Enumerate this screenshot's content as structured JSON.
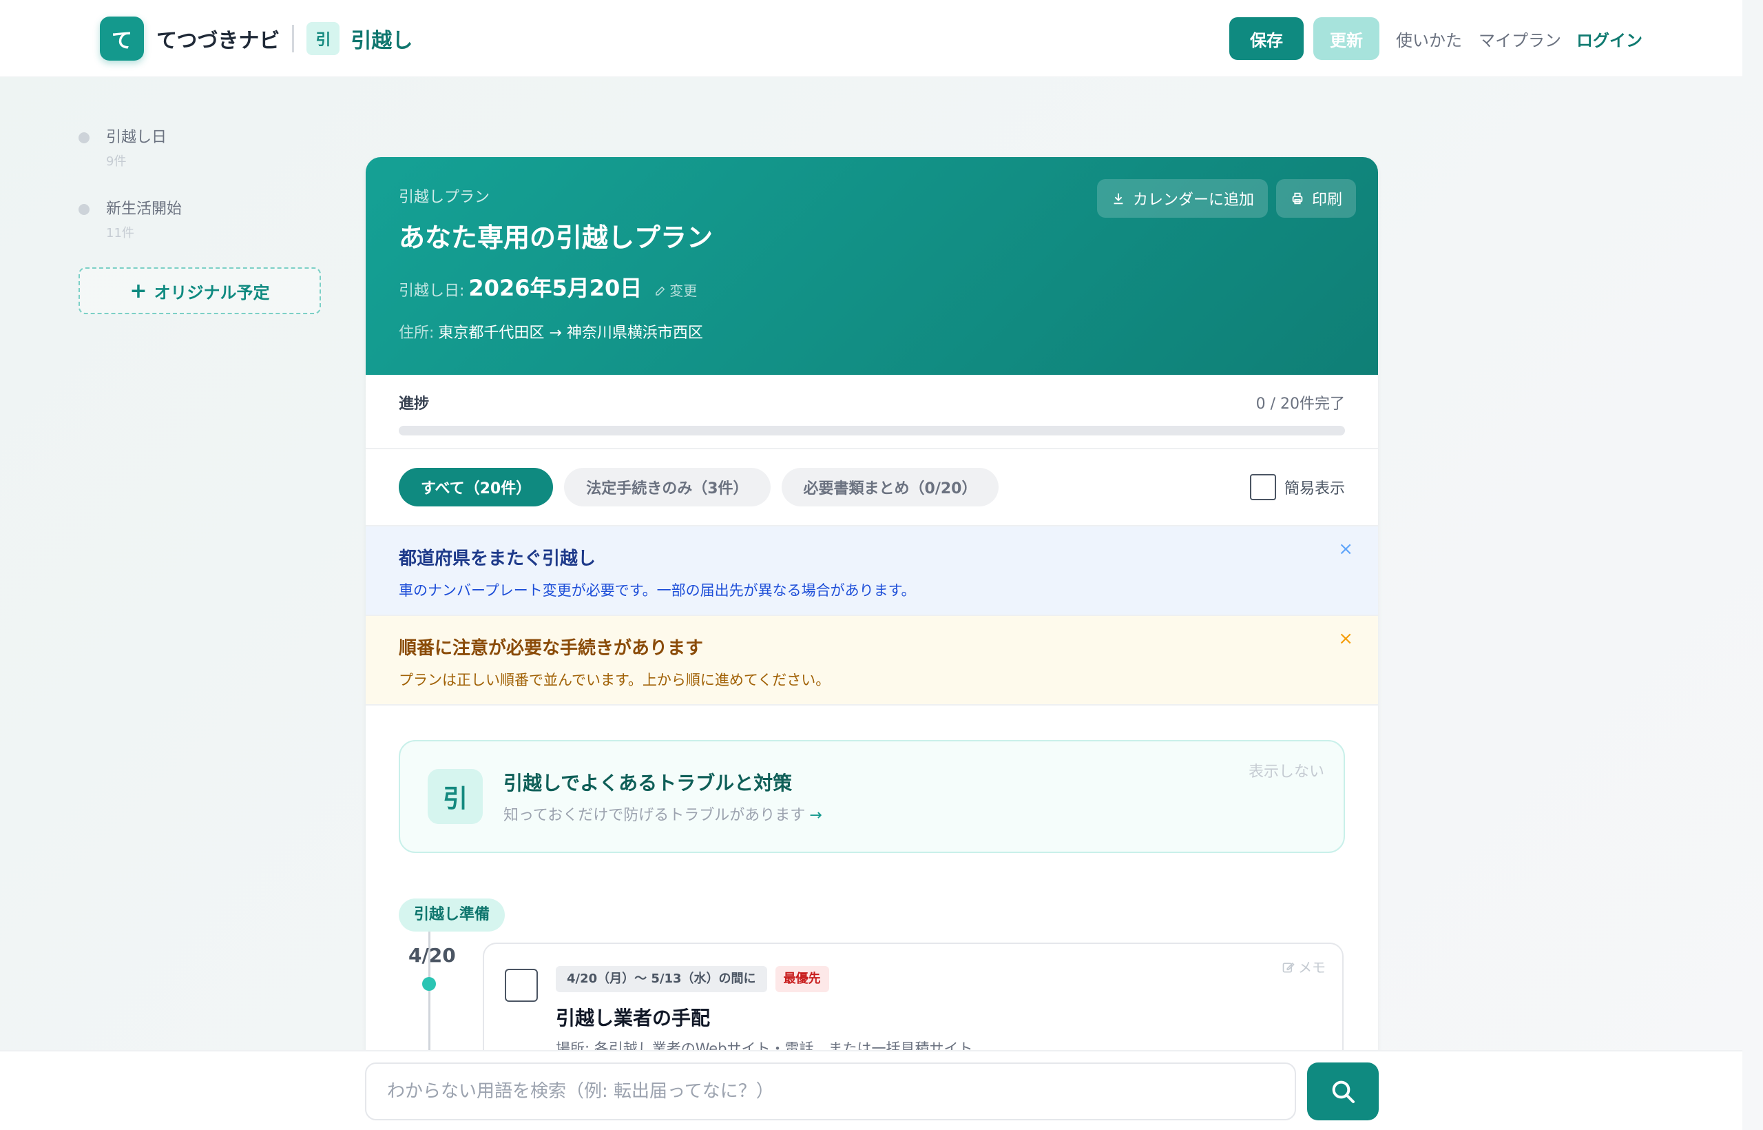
{
  "header": {
    "logo_letter": "て",
    "app_name": "てつづきナビ",
    "category_badge": "引",
    "category_name": "引越し",
    "save_label": "保存",
    "update_label": "更新",
    "nav_howto": "使いかた",
    "nav_myplan": "マイプラン",
    "nav_login": "ログイン"
  },
  "sidebar": {
    "items": [
      {
        "title": "引越し日",
        "count": "9件"
      },
      {
        "title": "新生活開始",
        "count": "11件"
      }
    ],
    "add_label": "オリジナル予定",
    "add_icon": "+"
  },
  "hero": {
    "kicker": "引越しプラン",
    "title": "あなた専用の引越しプラン",
    "date_label": "引越し日:",
    "date_value": "2026年5月20日",
    "edit_label": "変更",
    "address_label": "住所:",
    "address_value": "東京都千代田区 → 神奈川県横浜市西区",
    "calendar_label": "カレンダーに追加",
    "print_label": "印刷"
  },
  "progress": {
    "label": "進捗",
    "count_text": "0 / 20件完了",
    "fraction": 0
  },
  "filters": {
    "all": "すべて（20件）",
    "legal_only": "法定手続きのみ（3件）",
    "documents": "必要書類まとめ（0/20）",
    "simple_view": "簡易表示"
  },
  "notices": {
    "prefecture": {
      "title": "都道府県をまたぐ引越し",
      "text": "車のナンバープレート変更が必要です。一部の届出先が異なる場合があります。",
      "close": "×"
    },
    "order": {
      "title": "順番に注意が必要な手続きがあります",
      "text": "プランは正しい順番で並んでいます。上から順に進めてください。",
      "close": "×"
    }
  },
  "tip": {
    "icon_letter": "引",
    "title": "引越しでよくあるトラブルと対策",
    "subtitle": "知っておくだけで防げるトラブルがあります",
    "arrow": "→",
    "hide": "表示しない"
  },
  "timeline": {
    "phase": "引越し準備",
    "date": "4/20",
    "task": {
      "when": "4/20（月）〜 5/13（水）の間に",
      "priority": "最優先",
      "title": "引越し業者の手配",
      "place": "場所: 各引越し業者のWebサイト・電話、または一括見積サイト",
      "memo": "メモ"
    }
  },
  "search": {
    "placeholder": "わからない用語を検索（例: 転出届ってなに？）"
  },
  "colors": {
    "brand": "#0f8a80",
    "hero_start": "#15a195",
    "hero_end": "#0f7f76",
    "priority": "#c81e1e"
  }
}
